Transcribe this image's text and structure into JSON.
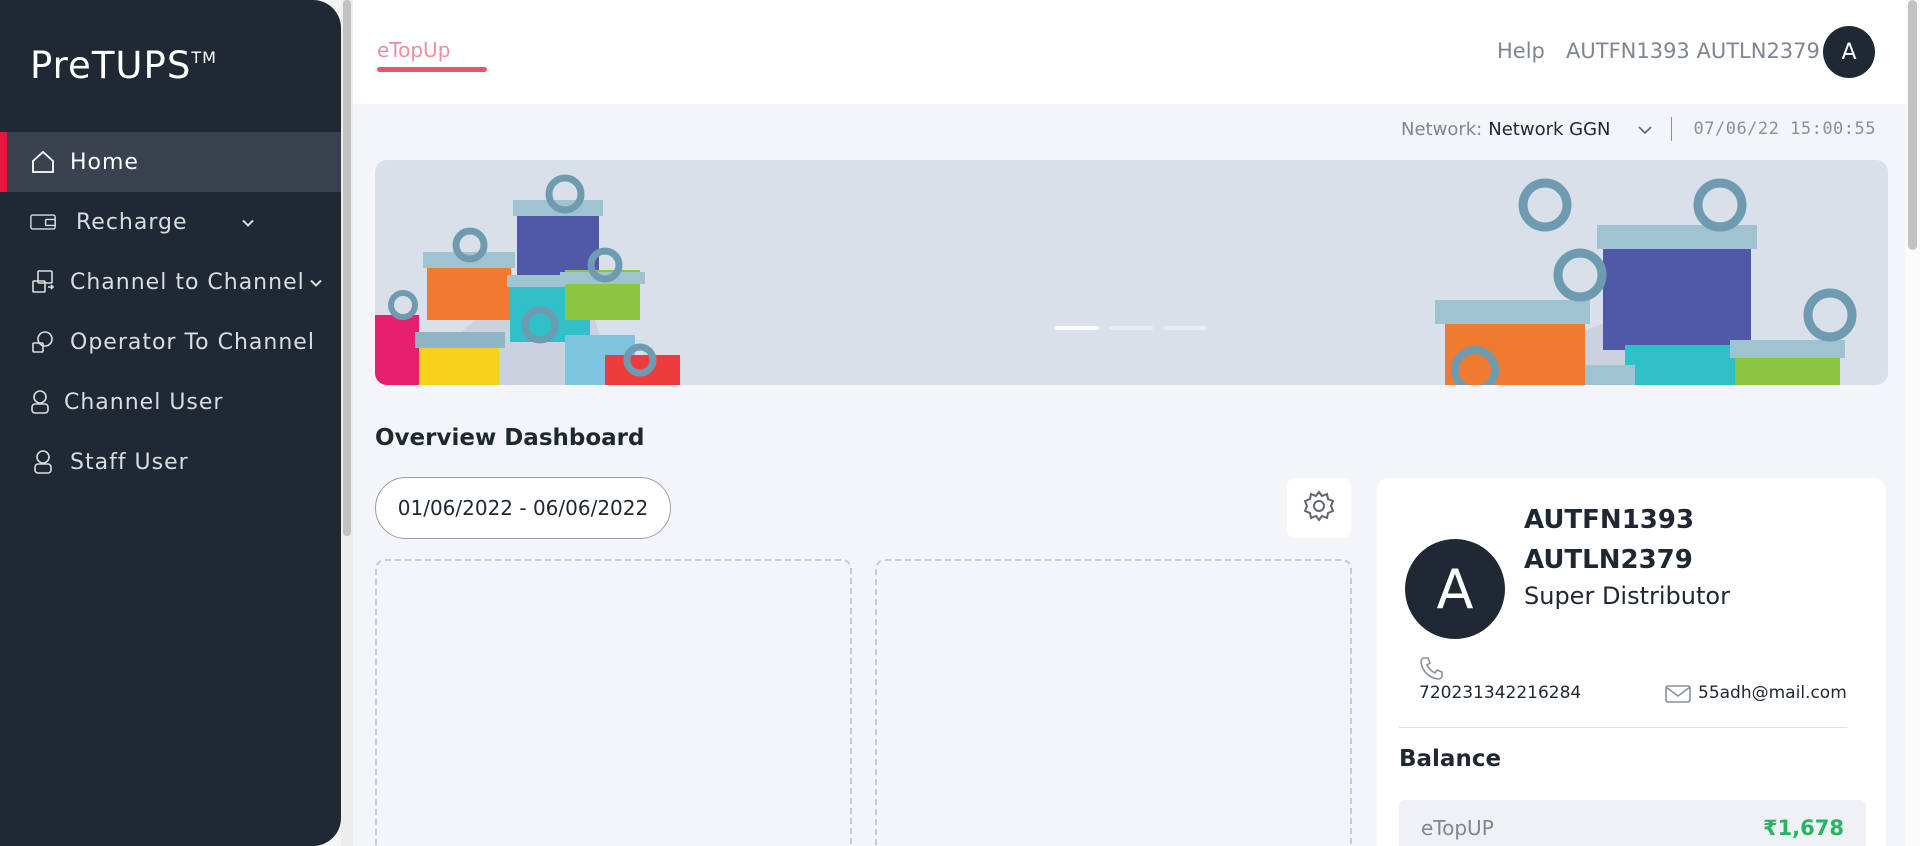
{
  "sidebar": {
    "logo": "PreTUPS",
    "logo_tm": "TM",
    "items": [
      {
        "label": "Home",
        "icon": "home-icon",
        "active": true
      },
      {
        "label": "Recharge",
        "icon": "recharge-icon",
        "expandable": true
      },
      {
        "label": "Channel to Channel",
        "icon": "channel-transfer-icon",
        "expandable": true
      },
      {
        "label": "Operator To Channel",
        "icon": "operator-icon"
      },
      {
        "label": "Channel User",
        "icon": "user-icon"
      },
      {
        "label": "Staff User",
        "icon": "user-icon"
      }
    ]
  },
  "header": {
    "tab": "eTopUp",
    "help": "Help",
    "user_name": "AUTFN1393 AUTLN2379",
    "avatar_initial": "A"
  },
  "network": {
    "label": "Network:",
    "value": "Network GGN",
    "datetime": "07/06/22 15:00:55"
  },
  "overview": {
    "title": "Overview Dashboard",
    "date_range": "01/06/2022 - 06/06/2022"
  },
  "profile": {
    "avatar_initial": "A",
    "name": "AUTFN1393 AUTLN2379",
    "role": "Super Distributor",
    "phone": "720231342216284",
    "email": "55adh@mail.com",
    "balance_title": "Balance",
    "balance_label": "eTopUP",
    "balance_value": "₹1,678"
  },
  "colors": {
    "sidebar_bg": "#1f2833",
    "accent_red": "#e4173e",
    "tab_pink": "#e8546e",
    "balance_green": "#28b463"
  }
}
